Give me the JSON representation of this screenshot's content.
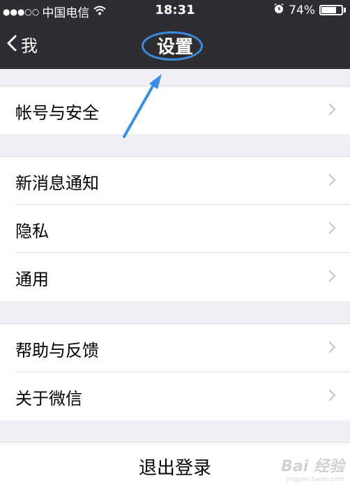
{
  "status_bar": {
    "signal_dots": "●●●○○",
    "carrier": "中国电信",
    "time": "18:31",
    "battery_percent": "74%",
    "battery_level": 0.74,
    "icons": [
      "signal-dots-icon",
      "wifi-icon",
      "alarm-icon",
      "battery-icon"
    ]
  },
  "nav": {
    "back_label": "我",
    "title": "设置",
    "back_icon": "chevron-left-icon"
  },
  "groups": [
    {
      "items": [
        {
          "label": "帐号与安全"
        }
      ]
    },
    {
      "items": [
        {
          "label": "新消息通知"
        },
        {
          "label": "隐私"
        },
        {
          "label": "通用"
        }
      ]
    },
    {
      "items": [
        {
          "label": "帮助与反馈"
        },
        {
          "label": "关于微信"
        }
      ]
    }
  ],
  "logout": {
    "label": "退出登录"
  },
  "watermark": {
    "brand": "Bai 经验",
    "url": "jingyan.baidu.com"
  },
  "colors": {
    "nav_background": "#2e2e32",
    "page_background": "#efeff4",
    "annotation_blue": "#3a8ee6",
    "chevron": "#c7c7cc"
  }
}
